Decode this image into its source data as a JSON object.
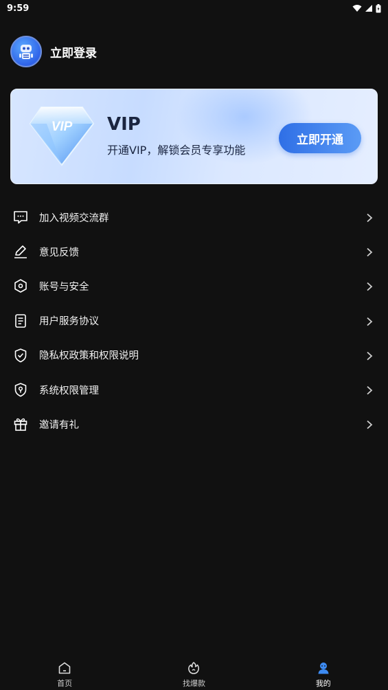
{
  "status_bar": {
    "time": "9:59"
  },
  "profile": {
    "login_label": "立即登录"
  },
  "vip": {
    "title": "VIP",
    "subtitle": "开通VIP，解锁会员专享功能",
    "button_label": "立即开通",
    "gem_text": "VIP",
    "accent_color": "#2f6fe6"
  },
  "menu": {
    "items": [
      {
        "label": "加入视频交流群",
        "icon": "chat-bubble-icon"
      },
      {
        "label": "意见反馈",
        "icon": "pen-icon"
      },
      {
        "label": "账号与安全",
        "icon": "hexagon-security-icon"
      },
      {
        "label": "用户服务协议",
        "icon": "document-icon"
      },
      {
        "label": "隐私权政策和权限说明",
        "icon": "shield-check-icon"
      },
      {
        "label": "系统权限管理",
        "icon": "shield-key-icon"
      },
      {
        "label": "邀请有礼",
        "icon": "gift-icon"
      }
    ]
  },
  "bottom_nav": {
    "items": [
      {
        "label": "首页",
        "icon": "home-icon",
        "active": false
      },
      {
        "label": "找爆款",
        "icon": "fire-icon",
        "active": false
      },
      {
        "label": "我的",
        "icon": "profile-icon",
        "active": true
      }
    ]
  }
}
